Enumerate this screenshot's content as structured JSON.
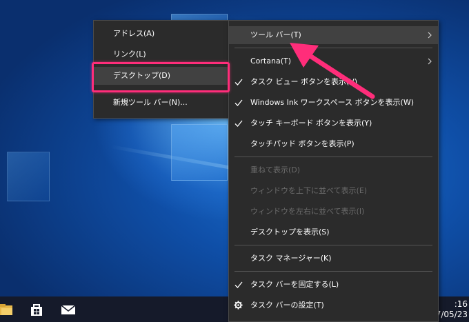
{
  "submenu": {
    "items": [
      {
        "label": "アドレス(A)"
      },
      {
        "label": "リンク(L)"
      },
      {
        "label": "デスクトップ(D)"
      },
      {
        "label": "新規ツール バー(N)..."
      }
    ]
  },
  "context_menu": {
    "items": [
      {
        "label": "ツール バー(T)"
      },
      {
        "label": "Cortana(T)"
      },
      {
        "label": "タスク ビュー ボタンを表示(V)"
      },
      {
        "label": "Windows Ink ワークスペース ボタンを表示(W)"
      },
      {
        "label": "タッチ キーボード ボタンを表示(Y)"
      },
      {
        "label": "タッチパッド ボタンを表示(P)"
      },
      {
        "label": "重ねて表示(D)"
      },
      {
        "label": "ウィンドウを上下に並べて表示(E)"
      },
      {
        "label": "ウィンドウを左右に並べて表示(I)"
      },
      {
        "label": "デスクトップを表示(S)"
      },
      {
        "label": "タスク マネージャー(K)"
      },
      {
        "label": "タスク バーを固定する(L)"
      },
      {
        "label": "タスク バーの設定(T)"
      }
    ]
  },
  "taskbar": {
    "time": ":16",
    "date": "7/05/23",
    "icons": [
      "file-explorer-icon",
      "store-icon",
      "mail-icon"
    ]
  },
  "colors": {
    "menu_bg": "#2b2b2b",
    "menu_highlight": "#414141",
    "annotation_pink": "#ff2d7a",
    "taskbar_bg": "#151a2a"
  }
}
